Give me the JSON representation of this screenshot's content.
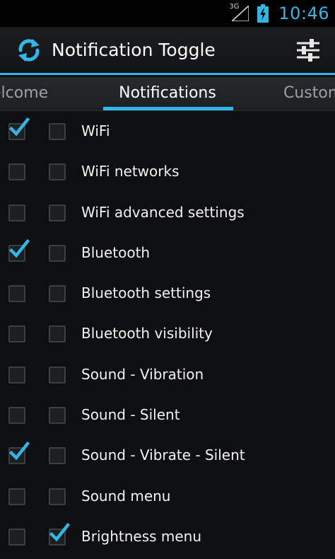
{
  "status_bar": {
    "network": "3G",
    "time": "10:46",
    "accent": "#33b5e5"
  },
  "action_bar": {
    "title": "Notification Toggle",
    "app_icon": "sync-arrows-icon",
    "settings_icon": "sliders-icon"
  },
  "tabs": [
    {
      "label": "Welcome"
    },
    {
      "label": "Notifications",
      "selected": true
    },
    {
      "label": "Custom"
    }
  ],
  "tabs_visible": {
    "left": "elcome",
    "center": "Notifications",
    "right": "Custom"
  },
  "rows": [
    {
      "label": "WiFi",
      "check1": true,
      "check2": false
    },
    {
      "label": "WiFi networks",
      "check1": false,
      "check2": false
    },
    {
      "label": "WiFi advanced settings",
      "check1": false,
      "check2": false
    },
    {
      "label": "Bluetooth",
      "check1": true,
      "check2": false
    },
    {
      "label": "Bluetooth settings",
      "check1": false,
      "check2": false
    },
    {
      "label": "Bluetooth visibility",
      "check1": false,
      "check2": false
    },
    {
      "label": "Sound - Vibration",
      "check1": false,
      "check2": false
    },
    {
      "label": "Sound - Silent",
      "check1": false,
      "check2": false
    },
    {
      "label": "Sound - Vibrate - Silent",
      "check1": true,
      "check2": false
    },
    {
      "label": "Sound menu",
      "check1": false,
      "check2": false
    },
    {
      "label": "Brightness menu",
      "check1": false,
      "check2": true
    }
  ]
}
